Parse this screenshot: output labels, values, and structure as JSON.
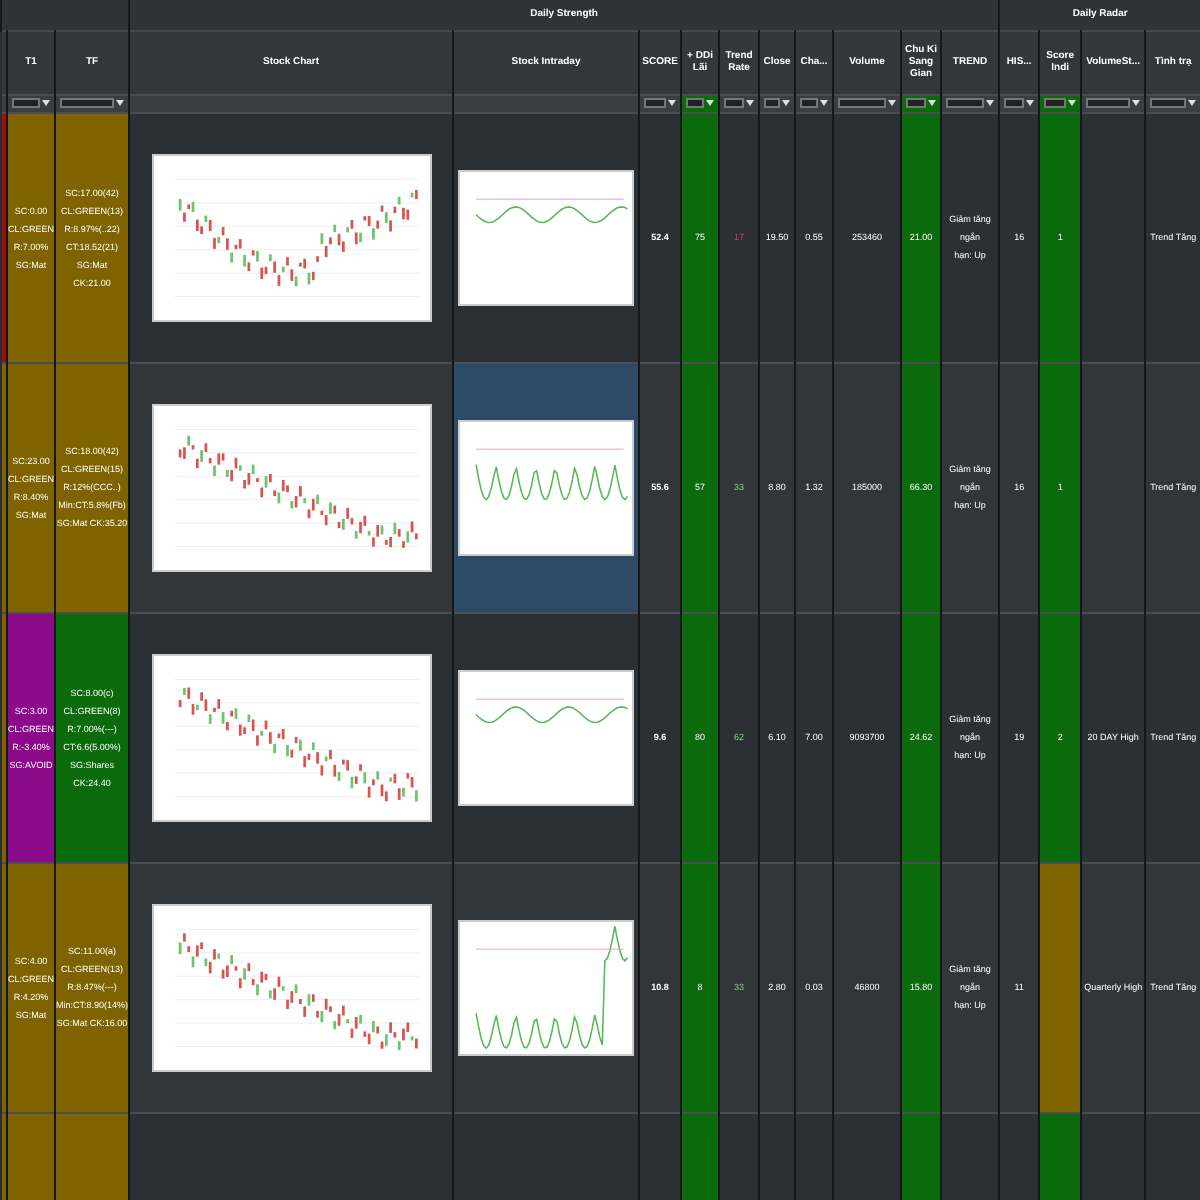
{
  "groups": [
    {
      "label": "Daily Strength"
    },
    {
      "label": "Daily Radar"
    }
  ],
  "columns": [
    {
      "header": "T1",
      "filter": true
    },
    {
      "header": "TF",
      "filter": true
    },
    {
      "header": "Stock Chart",
      "filter": false
    },
    {
      "header": "Stock Intraday",
      "filter": false
    },
    {
      "header": "SCORE",
      "filter": true
    },
    {
      "header": "+ DDi Lãi",
      "filter": true
    },
    {
      "header": "Trend Rate",
      "filter": true
    },
    {
      "header": "Close",
      "filter": true
    },
    {
      "header": "Cha...",
      "filter": true
    },
    {
      "header": "Volume",
      "filter": true
    },
    {
      "header": "Chu Ki Sang Gian",
      "filter": true
    },
    {
      "header": "TREND",
      "filter": true
    },
    {
      "header": "HIS...",
      "filter": true
    },
    {
      "header": "Score Indi",
      "filter": true
    },
    {
      "header": "VolumeSt...",
      "filter": true
    },
    {
      "header": "Tình trạ",
      "filter": true
    }
  ],
  "rows": [
    {
      "cells": [
        {
          "kind": "strip",
          "color": "#9a1010"
        },
        {
          "kind": "text",
          "text": "SC:0.00\nCL:GREEN\nR:7.00%\nSG:Mat",
          "color": "#7f6300"
        },
        {
          "kind": "text",
          "text": "SC:17.00(42)\nCL:GREEN(13)\nR:8.97%(..22)\nCT:18.52(21)\nSG:Mat\nCK:21.00",
          "color": "#7f6300"
        },
        {
          "kind": "candles"
        },
        {
          "kind": "intraday",
          "selected": false
        },
        {
          "kind": "score",
          "text": "52.4"
        },
        {
          "kind": "text",
          "text": "75",
          "color": "#0b6a0b"
        },
        {
          "kind": "rate_down",
          "text": "17"
        },
        {
          "kind": "text",
          "text": "19.50"
        },
        {
          "kind": "text",
          "text": "0.55"
        },
        {
          "kind": "text",
          "text": "253460"
        },
        {
          "kind": "text",
          "text": "21.00",
          "color": "#0b6a0b"
        },
        {
          "kind": "text",
          "text": "Giảm tăng ngắn\nhạn: Up"
        },
        {
          "kind": "text",
          "text": "16"
        },
        {
          "kind": "text",
          "text": "1",
          "color": "#0b6a0b"
        },
        {
          "kind": "empty"
        },
        {
          "kind": "text",
          "text": "Trend Tăng"
        }
      ]
    },
    {
      "cells": [
        {
          "kind": "strip",
          "color": "#7f6300"
        },
        {
          "kind": "text",
          "text": "SC:23.00\nCL:GREEN\nR:8.40%\nSG:Mat",
          "color": "#7f6300"
        },
        {
          "kind": "text",
          "text": "SC:18.00(42)\nCL:GREEN(15)\nR:12%(CCC..)\nMin:CT:5.8%(Fb)\nSG:Mat CK:35.20",
          "color": "#7f6300"
        },
        {
          "kind": "candles"
        },
        {
          "kind": "intraday",
          "selected": true
        },
        {
          "kind": "score",
          "text": "55.6"
        },
        {
          "kind": "text",
          "text": "57",
          "color": "#0b6a0b"
        },
        {
          "kind": "rate_up",
          "text": "33"
        },
        {
          "kind": "text",
          "text": "8.80"
        },
        {
          "kind": "text",
          "text": "1.32"
        },
        {
          "kind": "text",
          "text": "185000"
        },
        {
          "kind": "text",
          "text": "66.30",
          "color": "#0b6a0b"
        },
        {
          "kind": "text",
          "text": "Giảm tăng ngắn\nhạn: Up"
        },
        {
          "kind": "text",
          "text": "16"
        },
        {
          "kind": "text",
          "text": "1",
          "color": "#0b6a0b"
        },
        {
          "kind": "empty"
        },
        {
          "kind": "text",
          "text": "Trend Tăng"
        }
      ]
    },
    {
      "cells": [
        {
          "kind": "strip",
          "color": "#7f6300"
        },
        {
          "kind": "text",
          "text": "SC:3.00\nCL:GREEN\nR:-3.40%\nSG:AVOID",
          "color": "#8a0a8a"
        },
        {
          "kind": "text",
          "text": "SC:8.00(c)\nCL:GREEN(8)\nR:7.00%(---)\nCT:6.6(5.00%)\nSG:Shares\nCK:24.40",
          "color": "#0b6a0b"
        },
        {
          "kind": "candles"
        },
        {
          "kind": "intraday",
          "selected": false
        },
        {
          "kind": "score",
          "text": "9.6"
        },
        {
          "kind": "text",
          "text": "80",
          "color": "#0b6a0b"
        },
        {
          "kind": "rate_up",
          "text": "62"
        },
        {
          "kind": "text",
          "text": "6.10"
        },
        {
          "kind": "text",
          "text": "7.00"
        },
        {
          "kind": "text",
          "text": "9093700"
        },
        {
          "kind": "text",
          "text": "24.62",
          "color": "#0b6a0b"
        },
        {
          "kind": "text",
          "text": "Giảm tăng ngắn\nhạn: Up"
        },
        {
          "kind": "text",
          "text": "19"
        },
        {
          "kind": "text",
          "text": "2",
          "color": "#0b6a0b"
        },
        {
          "kind": "text",
          "text": "20 DAY High"
        },
        {
          "kind": "text",
          "text": "Trend Tăng"
        }
      ]
    },
    {
      "cells": [
        {
          "kind": "strip",
          "color": "#7f6300"
        },
        {
          "kind": "text",
          "text": "SC:4.00\nCL:GREEN\nR:4.20%\nSG:Mat",
          "color": "#7f6300"
        },
        {
          "kind": "text",
          "text": "SC:11.00(a)\nCL:GREEN(13)\nR:8.47%(---)\nMin:CT:8.90(14%)\nSG:Mat CK:16.00",
          "color": "#7f6300"
        },
        {
          "kind": "candles"
        },
        {
          "kind": "intraday",
          "selected": false
        },
        {
          "kind": "score",
          "text": "10.8"
        },
        {
          "kind": "text",
          "text": "8",
          "color": "#0b6a0b"
        },
        {
          "kind": "rate_up",
          "text": "33"
        },
        {
          "kind": "text",
          "text": "2.80"
        },
        {
          "kind": "text",
          "text": "0.03"
        },
        {
          "kind": "text",
          "text": "46800"
        },
        {
          "kind": "text",
          "text": "15.80",
          "color": "#0b6a0b"
        },
        {
          "kind": "text",
          "text": "Giảm tăng ngắn\nhạn: Up"
        },
        {
          "kind": "text",
          "text": "11"
        },
        {
          "kind": "empty",
          "color": "#7f6300"
        },
        {
          "kind": "text",
          "text": "Quarterly High"
        },
        {
          "kind": "text",
          "text": "Trend Tăng"
        }
      ]
    },
    {
      "cells": [
        {
          "kind": "strip",
          "color": "#7f6300"
        },
        {
          "kind": "empty",
          "color": "#7f6300"
        },
        {
          "kind": "empty",
          "color": "#7f6300"
        },
        {
          "kind": "empty"
        },
        {
          "kind": "empty"
        },
        {
          "kind": "empty"
        },
        {
          "kind": "empty",
          "color": "#0b6a0b"
        },
        {
          "kind": "empty"
        },
        {
          "kind": "empty"
        },
        {
          "kind": "empty"
        },
        {
          "kind": "empty"
        },
        {
          "kind": "empty",
          "color": "#0b6a0b"
        },
        {
          "kind": "empty"
        },
        {
          "kind": "empty"
        },
        {
          "kind": "empty",
          "color": "#0b6a0b"
        },
        {
          "kind": "empty"
        },
        {
          "kind": "empty"
        }
      ]
    }
  ]
}
